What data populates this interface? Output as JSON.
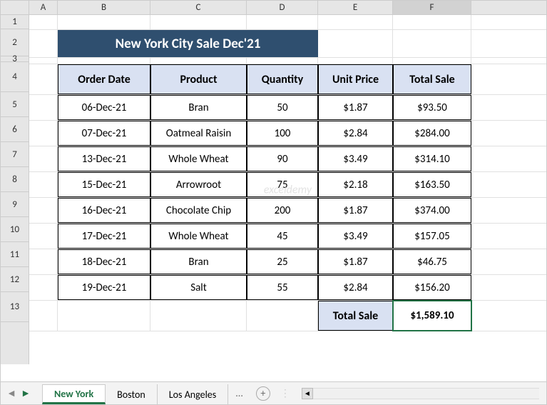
{
  "columns": [
    {
      "letter": "A",
      "width": 40
    },
    {
      "letter": "B",
      "width": 130
    },
    {
      "letter": "C",
      "width": 135
    },
    {
      "letter": "D",
      "width": 100
    },
    {
      "letter": "E",
      "width": 105
    },
    {
      "letter": "F",
      "width": 110
    }
  ],
  "selected_col": "F",
  "rows": [
    {
      "n": 1,
      "h": 20
    },
    {
      "n": 2,
      "h": 38
    },
    {
      "n": 3,
      "h": 8
    },
    {
      "n": 4,
      "h": 42
    },
    {
      "n": 5,
      "h": 35
    },
    {
      "n": 6,
      "h": 35
    },
    {
      "n": 7,
      "h": 35
    },
    {
      "n": 8,
      "h": 35
    },
    {
      "n": 9,
      "h": 35
    },
    {
      "n": 10,
      "h": 35
    },
    {
      "n": 11,
      "h": 35
    },
    {
      "n": 12,
      "h": 35
    },
    {
      "n": 13,
      "h": 42
    }
  ],
  "title": "New York City Sale Dec'21",
  "headers": [
    "Order Date",
    "Product",
    "Quantity",
    "Unit Price",
    "Total Sale"
  ],
  "data": [
    [
      "06-Dec-21",
      "Bran",
      "50",
      "$1.87",
      "$93.50"
    ],
    [
      "07-Dec-21",
      "Oatmeal Raisin",
      "100",
      "$2.84",
      "$284.00"
    ],
    [
      "13-Dec-21",
      "Whole Wheat",
      "90",
      "$3.49",
      "$314.10"
    ],
    [
      "15-Dec-21",
      "Arrowroot",
      "75",
      "$2.18",
      "$163.50"
    ],
    [
      "16-Dec-21",
      "Chocolate Chip",
      "200",
      "$1.87",
      "$374.00"
    ],
    [
      "17-Dec-21",
      "Whole Wheat",
      "45",
      "$3.49",
      "$157.05"
    ],
    [
      "18-Dec-21",
      "Bran",
      "25",
      "$1.87",
      "$46.75"
    ],
    [
      "19-Dec-21",
      "Salt",
      "55",
      "$2.84",
      "$156.20"
    ]
  ],
  "total_label": "Total Sale",
  "total_value": "$1,589.10",
  "watermark": "exceldemy",
  "tabs": {
    "active": "New York",
    "others": [
      "Boston",
      "Los Angeles"
    ],
    "more": "..."
  }
}
